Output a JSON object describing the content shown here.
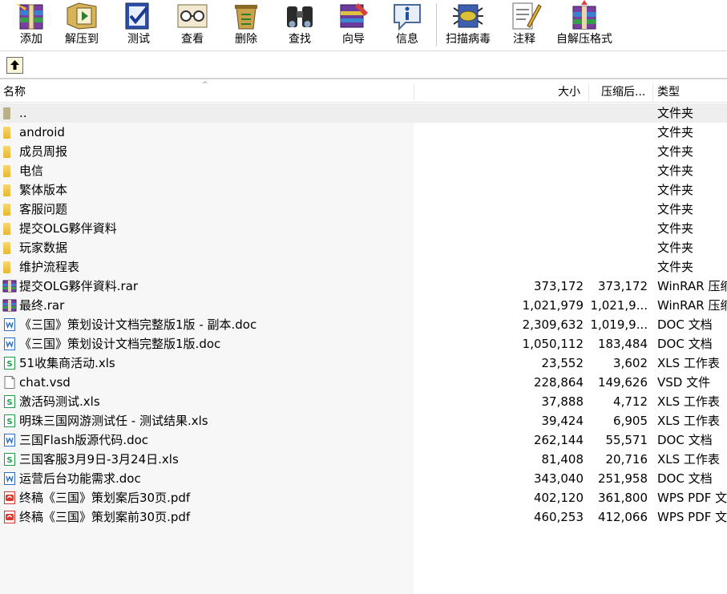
{
  "toolbar": {
    "buttons": [
      {
        "id": "add",
        "label": "添加",
        "icon": "archive-add-icon"
      },
      {
        "id": "extract",
        "label": "解压到",
        "icon": "extract-to-icon"
      },
      {
        "id": "test",
        "label": "测试",
        "icon": "test-check-icon"
      },
      {
        "id": "view",
        "label": "查看",
        "icon": "view-glasses-icon"
      },
      {
        "id": "delete",
        "label": "删除",
        "icon": "delete-recycle-icon"
      },
      {
        "id": "find",
        "label": "查找",
        "icon": "binoculars-icon"
      },
      {
        "id": "wizard",
        "label": "向导",
        "icon": "wizard-icon"
      },
      {
        "id": "info",
        "label": "信息",
        "icon": "info-icon"
      },
      {
        "id": "scan",
        "label": "扫描病毒",
        "icon": "virus-scan-icon"
      },
      {
        "id": "comment",
        "label": "注释",
        "icon": "comment-pen-icon"
      },
      {
        "id": "sfx",
        "label": "自解压格式",
        "icon": "self-extract-icon"
      }
    ]
  },
  "header": {
    "name": "名称",
    "size": "大小",
    "packed": "压缩后...",
    "type": "类型"
  },
  "colors": {
    "folder": "#e9b92f",
    "doc_blue": "#2b6cc4",
    "xls_green": "#1e9e4a",
    "pdf_red": "#d9362e",
    "selected_row": "#eeeeee"
  },
  "files": [
    {
      "name": "..",
      "size": "",
      "packed": "",
      "type": "文件夹",
      "kind": "folder-up"
    },
    {
      "name": "android",
      "size": "",
      "packed": "",
      "type": "文件夹",
      "kind": "folder"
    },
    {
      "name": "成员周报",
      "size": "",
      "packed": "",
      "type": "文件夹",
      "kind": "folder"
    },
    {
      "name": "电信",
      "size": "",
      "packed": "",
      "type": "文件夹",
      "kind": "folder"
    },
    {
      "name": "繁体版本",
      "size": "",
      "packed": "",
      "type": "文件夹",
      "kind": "folder"
    },
    {
      "name": "客服问题",
      "size": "",
      "packed": "",
      "type": "文件夹",
      "kind": "folder"
    },
    {
      "name": "提交OLG夥伴資料",
      "size": "",
      "packed": "",
      "type": "文件夹",
      "kind": "folder"
    },
    {
      "name": "玩家数据",
      "size": "",
      "packed": "",
      "type": "文件夹",
      "kind": "folder"
    },
    {
      "name": "维护流程表",
      "size": "",
      "packed": "",
      "type": "文件夹",
      "kind": "folder"
    },
    {
      "name": "提交OLG夥伴資料.rar",
      "size": "373,172",
      "packed": "373,172",
      "type": "WinRAR 压缩",
      "kind": "rar"
    },
    {
      "name": "最终.rar",
      "size": "1,021,979",
      "packed": "1,021,9...",
      "type": "WinRAR 压缩",
      "kind": "rar"
    },
    {
      "name": "《三国》策划设计文档完整版1版 - 副本.doc",
      "size": "2,309,632",
      "packed": "1,019,9...",
      "type": "DOC 文档",
      "kind": "doc"
    },
    {
      "name": "《三国》策划设计文档完整版1版.doc",
      "size": "1,050,112",
      "packed": "183,484",
      "type": "DOC 文档",
      "kind": "doc"
    },
    {
      "name": "51收集商活动.xls",
      "size": "23,552",
      "packed": "3,602",
      "type": "XLS 工作表",
      "kind": "xls"
    },
    {
      "name": "chat.vsd",
      "size": "228,864",
      "packed": "149,626",
      "type": "VSD 文件",
      "kind": "blank"
    },
    {
      "name": "激活码测试.xls",
      "size": "37,888",
      "packed": "4,712",
      "type": "XLS 工作表",
      "kind": "xls"
    },
    {
      "name": "明珠三国网游测试任 - 测试结果.xls",
      "size": "39,424",
      "packed": "6,905",
      "type": "XLS 工作表",
      "kind": "xls"
    },
    {
      "name": "三国Flash版源代码.doc",
      "size": "262,144",
      "packed": "55,571",
      "type": "DOC 文档",
      "kind": "doc"
    },
    {
      "name": "三国客服3月9日-3月24日.xls",
      "size": "81,408",
      "packed": "20,716",
      "type": "XLS 工作表",
      "kind": "xls"
    },
    {
      "name": "运营后台功能需求.doc",
      "size": "343,040",
      "packed": "251,958",
      "type": "DOC 文档",
      "kind": "doc"
    },
    {
      "name": "终稿《三国》策划案后30页.pdf",
      "size": "402,120",
      "packed": "361,800",
      "type": "WPS PDF 文档",
      "kind": "pdf"
    },
    {
      "name": "终稿《三国》策划案前30页.pdf",
      "size": "460,253",
      "packed": "412,066",
      "type": "WPS PDF 文档",
      "kind": "pdf"
    }
  ]
}
